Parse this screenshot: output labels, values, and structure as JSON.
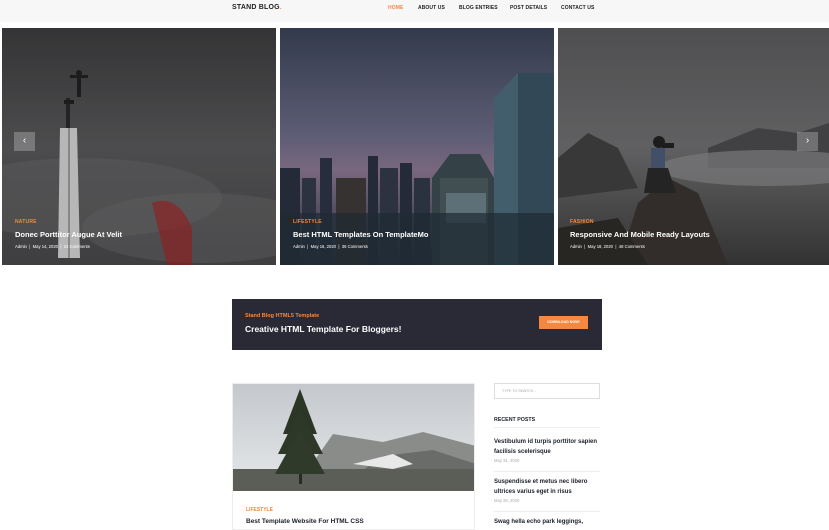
{
  "header": {
    "logo": "STAND BLOG",
    "logo_dot": ".",
    "nav": [
      "HOME",
      "ABOUT US",
      "BLOG ENTRIES",
      "POST DETAILS",
      "CONTACT US"
    ]
  },
  "slider": {
    "prev_icon": "‹",
    "next_icon": "›",
    "slides": [
      {
        "category": "NATURE",
        "title": "Donec Porttitor Augue At Velit",
        "meta": [
          "Admin",
          "May 14, 2020",
          "24 Comments"
        ]
      },
      {
        "category": "LIFESTYLE",
        "title": "Best HTML Templates On TemplateMo",
        "meta": [
          "Admin",
          "May 16, 2020",
          "36 Comments"
        ]
      },
      {
        "category": "FASHION",
        "title": "Responsive And Mobile Ready Layouts",
        "meta": [
          "Admin",
          "May 18, 2020",
          "48 Comments"
        ]
      }
    ]
  },
  "cta": {
    "subtitle": "Stand Blog HTML5 Template",
    "title": "Creative HTML Template For Bloggers!",
    "button": "DOWNLOAD NOW!"
  },
  "post": {
    "category": "LIFESTYLE",
    "title": "Best Template Website For HTML CSS"
  },
  "sidebar": {
    "search_placeholder": "TYPE TO SEARCH...",
    "recent_heading": "RECENT POSTS",
    "recent": [
      {
        "title": "Vestibulum id turpis porttitor sapien facilisis scelerisque",
        "date": "May 31, 2020"
      },
      {
        "title": "Suspendisse et metus nec libero ultrices varius eget in risus",
        "date": "May 28, 2020"
      },
      {
        "title": "Swag hella echo park leggings,",
        "date": ""
      }
    ]
  },
  "colors": {
    "accent": "#f48840",
    "dark": "#20232e"
  }
}
